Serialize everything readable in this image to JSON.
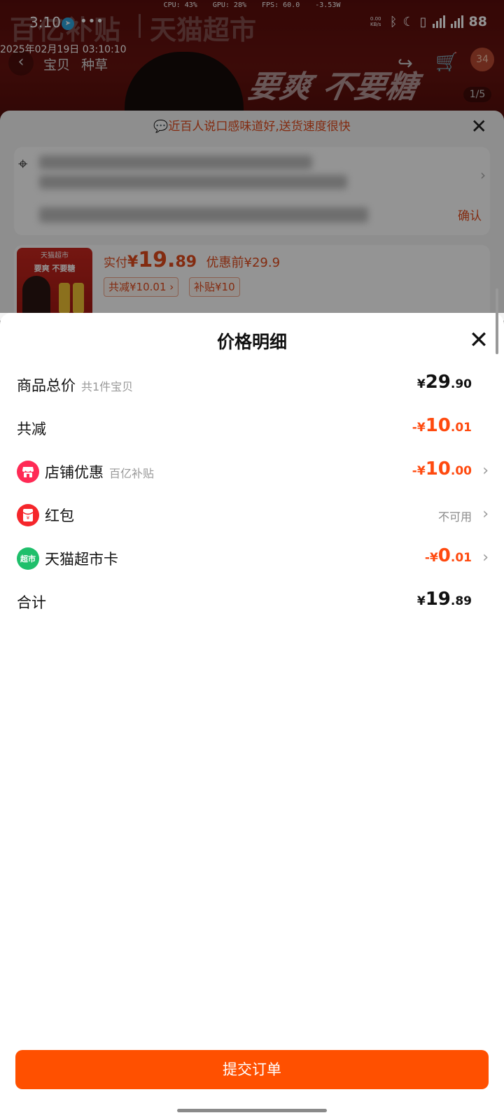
{
  "status_bar": {
    "time": "3:10",
    "perf": {
      "cpu": "CPU: 43%",
      "gpu": "GPU: 28%",
      "fps": "FPS: 60.0",
      "power": "-3.53W"
    },
    "net_speed": "0.00 KB/s",
    "battery": "88"
  },
  "datestamp": "2025年02月19日 03:10:10",
  "background": {
    "banner": {
      "left": "百亿补贴",
      "right": "天猫超市"
    },
    "slogan": "要爽 不要糖",
    "nav_tabs": [
      "宝贝",
      "种草"
    ],
    "cart_badge": "34",
    "pager": "1/5",
    "tip": "近百人说口感味道好,送货速度很快",
    "confirm_label": "确认",
    "goods": {
      "thumb_top": "天猫超市",
      "thumb_slogan": "要爽 不要糖",
      "paid_label": "实付",
      "paid_currency": "¥",
      "paid_int": "19.",
      "paid_dec": "89",
      "pre_discount": "优惠前¥29.9",
      "chip_reduce": "共减¥10.01 ›",
      "chip_subsidy": "补贴¥10"
    }
  },
  "sheet": {
    "title": "价格明细",
    "rows": [
      {
        "label": "商品总价",
        "sub": "共1件宝贝",
        "cur": "¥",
        "int": "29",
        "dec": ".90"
      },
      {
        "label": "共减",
        "cur": "-¥",
        "int": "10",
        "dec": ".01"
      },
      {
        "label": "店铺优惠",
        "sub": "百亿补贴",
        "cur": "-¥",
        "int": "10",
        "dec": ".00",
        "icon": "store-icon"
      },
      {
        "label": "红包",
        "text": "不可用",
        "icon": "red-envelope-icon"
      },
      {
        "label": "天猫超市卡",
        "cur": "-¥",
        "int": "0",
        "dec": ".01",
        "icon": "tmall-supermarket-card-icon",
        "icon_text": "超市"
      },
      {
        "label": "合计",
        "cur": "¥",
        "int": "19",
        "dec": ".89"
      }
    ],
    "submit_label": "提交订单"
  },
  "colors": {
    "accent": "#ff5000",
    "discount_red": "#ff4a0f",
    "store_icon": "#ff2a55",
    "envelope_icon": "#f5262b",
    "card_icon": "#1fbf6b"
  }
}
